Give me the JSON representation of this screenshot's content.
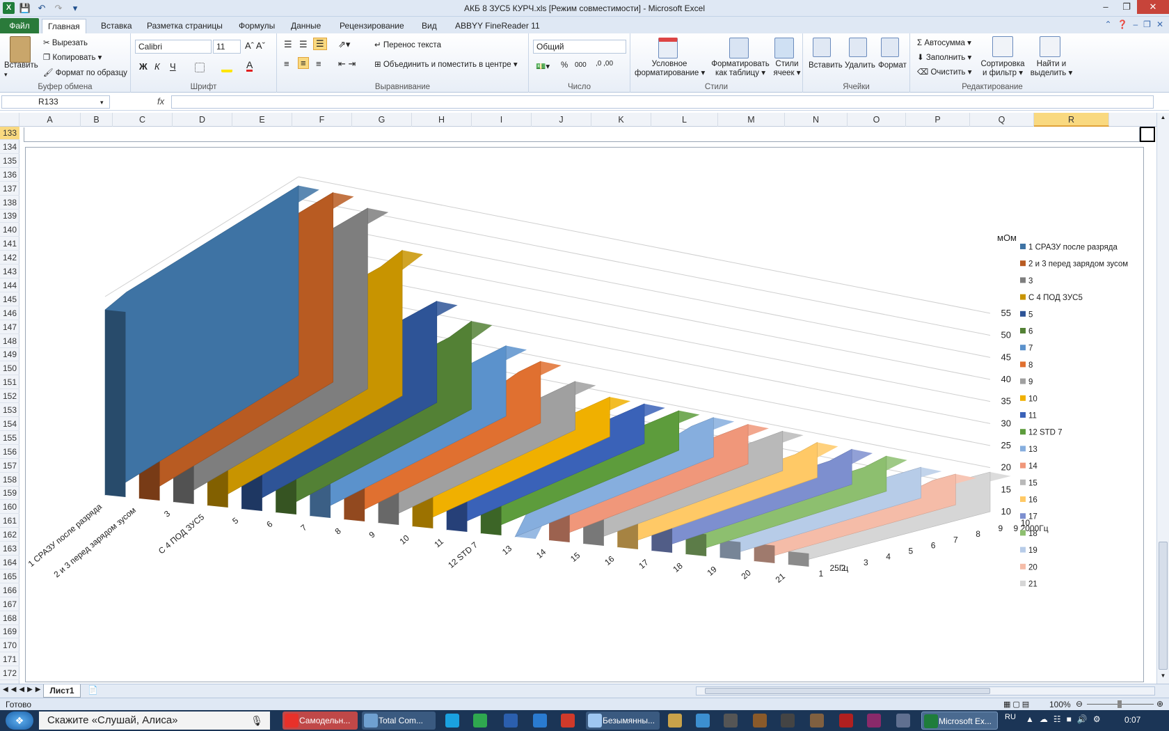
{
  "window": {
    "title": "АКБ 8 ЗУС5 КУРЧ.xls  [Режим совместимости]  -  Microsoft Excel"
  },
  "tabs": [
    "Файл",
    "Главная",
    "Вставка",
    "Разметка страницы",
    "Формулы",
    "Данные",
    "Рецензирование",
    "Вид",
    "ABBYY FineReader 11"
  ],
  "ribbon": {
    "clipboard": {
      "paste": "Вставить",
      "cut": "Вырезать",
      "copy": "Копировать",
      "format_painter": "Формат по образцу",
      "label": "Буфер обмена"
    },
    "font": {
      "name": "Calibri",
      "size": "11",
      "bold": "Ж",
      "italic": "К",
      "underline": "Ч",
      "label": "Шрифт"
    },
    "alignment": {
      "wrap": "Перенос текста",
      "merge": "Объединить и поместить в центре",
      "label": "Выравнивание"
    },
    "number": {
      "format": "Общий",
      "percent": "%",
      "thousands": "000",
      "label": "Число"
    },
    "styles": {
      "conditional": [
        "Условное",
        "форматирование"
      ],
      "as_table": [
        "Форматировать",
        "как таблицу"
      ],
      "cell_styles": [
        "Стили",
        "ячеек"
      ],
      "label": "Стили"
    },
    "cells": {
      "insert": "Вставить",
      "delete": "Удалить",
      "format": "Формат",
      "label": "Ячейки"
    },
    "editing": {
      "autosum": "Автосумма",
      "fill": "Заполнить",
      "clear": "Очистить",
      "sort": [
        "Сортировка",
        "и фильтр"
      ],
      "find": [
        "Найти и",
        "выделить"
      ],
      "label": "Редактирование"
    }
  },
  "formula_bar": {
    "name_box": "R133",
    "fx": "fx",
    "content": ""
  },
  "columns": [
    "A",
    "B",
    "C",
    "D",
    "E",
    "F",
    "G",
    "H",
    "I",
    "J",
    "K",
    "L",
    "M",
    "N",
    "O",
    "P",
    "Q",
    "R"
  ],
  "selected_column": "R",
  "rows": [
    "133",
    "134",
    "135",
    "136",
    "137",
    "138",
    "139",
    "140",
    "141",
    "142",
    "143",
    "144",
    "145",
    "146",
    "147",
    "148",
    "149",
    "150",
    "151",
    "152",
    "153",
    "154",
    "155",
    "156",
    "157",
    "158",
    "159",
    "160",
    "161",
    "162",
    "163",
    "164",
    "165",
    "166",
    "167",
    "168",
    "169",
    "170",
    "171",
    "172"
  ],
  "chart_data": {
    "type": "area",
    "subtype": "3d-area",
    "title": "",
    "zlabel": "мОм",
    "zlim": [
      10,
      55
    ],
    "zticks": [
      10,
      15,
      20,
      25,
      30,
      35,
      40,
      45,
      50,
      55
    ],
    "series_axis": [
      "1 СРАЗУ после разряда",
      "2 и 3 перед зарядом зусом",
      "3",
      "С 4 ПОД ЗУС5",
      "5",
      "6",
      "7",
      "8",
      "9",
      "10",
      "11",
      "12 STD 7",
      "13",
      "14",
      "15",
      "16",
      "17",
      "18",
      "19",
      "20",
      "21"
    ],
    "depth_axis_labels": [
      "1",
      "25Гц",
      "2",
      "3",
      "4",
      "5",
      "6",
      "7",
      "8",
      "9 2000Гц",
      "10"
    ],
    "depth_axis_ticks": [
      "1",
      "2",
      "3",
      "4",
      "5",
      "6",
      "7",
      "8",
      "9",
      "10"
    ],
    "legend_position": "right",
    "grid": true,
    "series": [
      {
        "name": "1 СРАЗУ после разряда",
        "color": "#3e73a4",
        "values": [
          52,
          53,
          53,
          53,
          53,
          53,
          53,
          53,
          53,
          53
        ]
      },
      {
        "name": "2 и 3 перед зарядом зусом",
        "color": "#b85b22",
        "values": [
          47,
          49,
          50,
          51,
          52,
          52,
          52,
          53,
          53,
          53
        ]
      },
      {
        "name": "3",
        "color": "#7e7e7e",
        "values": [
          46,
          47,
          48,
          49,
          50,
          51,
          51,
          51,
          51,
          51
        ]
      },
      {
        "name": "С 4 ПОД ЗУС5",
        "color": "#c89400",
        "values": [
          38,
          39,
          39,
          40,
          40,
          41,
          41,
          42,
          42,
          43
        ]
      },
      {
        "name": "5",
        "color": "#2e5497",
        "values": [
          30,
          30,
          31,
          31,
          32,
          32,
          32,
          33,
          33,
          33
        ]
      },
      {
        "name": "6",
        "color": "#538135",
        "values": [
          27,
          27,
          27,
          28,
          28,
          28,
          29,
          29,
          29,
          30
        ]
      },
      {
        "name": "7",
        "color": "#5b92cc",
        "values": [
          25,
          25,
          25,
          25,
          25,
          26,
          26,
          26,
          26,
          26
        ]
      },
      {
        "name": "8",
        "color": "#e07030",
        "values": [
          22,
          22,
          22,
          22,
          23,
          23,
          23,
          23,
          24,
          24
        ]
      },
      {
        "name": "9",
        "color": "#a0a0a0",
        "values": [
          20,
          20,
          20,
          20,
          20,
          20,
          20,
          21,
          21,
          21
        ]
      },
      {
        "name": "10",
        "color": "#f0b000",
        "values": [
          19,
          19,
          19,
          19,
          19,
          19,
          19,
          19,
          19,
          19
        ]
      },
      {
        "name": "11",
        "color": "#3a62b8",
        "values": [
          19,
          19,
          19,
          19,
          19,
          19,
          19,
          19,
          19,
          19
        ]
      },
      {
        "name": "12 STD 7",
        "color": "#5d9c3c",
        "values": [
          18,
          18,
          18,
          18,
          18,
          19,
          19,
          19,
          19,
          19
        ]
      },
      {
        "name": "13",
        "color": "#86aede",
        "values": [
          10,
          18,
          18,
          18,
          18,
          18,
          18,
          18,
          19,
          19
        ]
      },
      {
        "name": "14",
        "color": "#f0977a",
        "values": [
          17,
          17,
          17,
          17,
          17,
          18,
          18,
          19,
          19,
          19
        ]
      },
      {
        "name": "15",
        "color": "#b9b9b9",
        "values": [
          16,
          16,
          17,
          17,
          17,
          18,
          18,
          19,
          19,
          19
        ]
      },
      {
        "name": "16",
        "color": "#ffc966",
        "values": [
          16,
          16,
          16,
          16,
          17,
          17,
          17,
          17,
          17,
          18
        ]
      },
      {
        "name": "17",
        "color": "#7d8fcf",
        "values": [
          16,
          16,
          16,
          16,
          17,
          17,
          17,
          17,
          17,
          18
        ]
      },
      {
        "name": "18",
        "color": "#8dbf6f",
        "values": [
          15,
          15,
          15,
          16,
          16,
          16,
          17,
          17,
          17,
          18
        ]
      },
      {
        "name": "19",
        "color": "#b7cce8",
        "values": [
          14,
          14,
          15,
          15,
          16,
          16,
          16,
          17,
          17,
          17
        ]
      },
      {
        "name": "20",
        "color": "#f5bca8",
        "values": [
          14,
          14,
          14,
          15,
          15,
          15,
          16,
          16,
          17,
          17
        ]
      },
      {
        "name": "21",
        "color": "#d6d6d6",
        "values": [
          13,
          14,
          15,
          16,
          17,
          15,
          17,
          18,
          19,
          19
        ]
      }
    ]
  },
  "sheets": {
    "active": "Лист1"
  },
  "status": {
    "ready": "Готово",
    "zoom": "100%"
  },
  "taskbar": {
    "search": "Скажите «Слушай, Алиса»",
    "apps": [
      "Самодельн...",
      "Total Com...",
      "Безымянны...",
      "Microsoft Ex..."
    ],
    "lang": "RU",
    "time": "0:07"
  }
}
